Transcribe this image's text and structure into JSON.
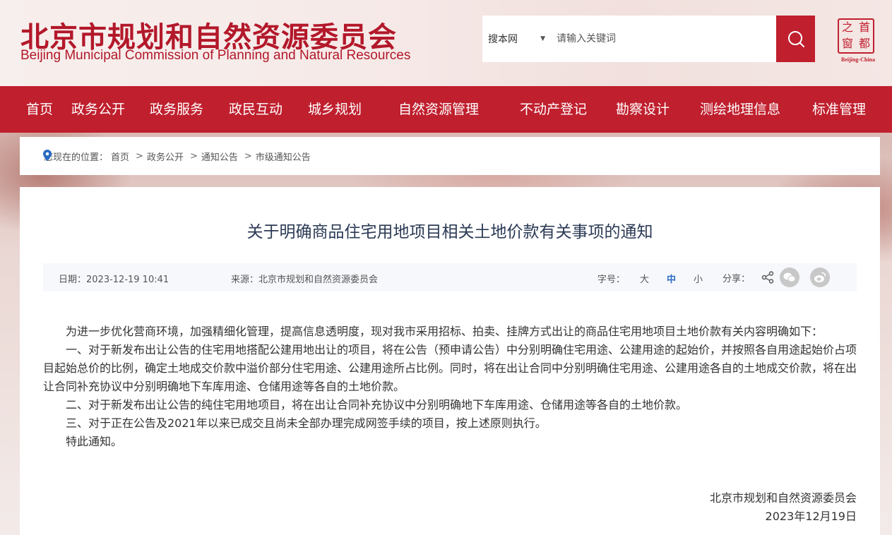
{
  "header": {
    "title_cn": "北京市规划和自然资源委员会",
    "title_en": "Beijing Municipal Commission of Planning and Natural Resources",
    "search": {
      "scope": "搜本网",
      "placeholder": "请输入关键词"
    },
    "seal": {
      "chars": [
        "之",
        "首",
        "窗",
        "都"
      ],
      "label": "Beijing-China"
    }
  },
  "nav": {
    "items": [
      "首页",
      "政务公开",
      "政务服务",
      "政民互动",
      "城乡规划",
      "自然资源管理",
      "不动产登记",
      "勘察设计",
      "测绘地理信息",
      "标准管理"
    ]
  },
  "breadcrumb": {
    "prefix": "您现在的位置：",
    "items": [
      "首页",
      "政务公开",
      "通知公告",
      "市级通知公告"
    ],
    "separator": ">"
  },
  "article": {
    "title": "关于明确商品住宅用地项目相关土地价款有关事项的通知",
    "meta": {
      "date": "日期：2023-12-19 10:41",
      "source": "来源：北京市规划和自然资源委员会",
      "font_size_label": "字号：",
      "font_sizes": [
        "大",
        "中",
        "小"
      ],
      "share_label": "分享："
    },
    "paragraphs": [
      "为进一步优化营商环境，加强精细化管理，提高信息透明度，现对我市采用招标、拍卖、挂牌方式出让的商品住宅用地项目土地价款有关内容明确如下：",
      "一、对于新发布出让公告的住宅用地搭配公建用地出让的项目，将在公告（预申请公告）中分别明确住宅用途、公建用途的起始价，并按照各自用途起始价占项目起始总价的比例，确定土地成交价款中溢价部分住宅用途、公建用途所占比例。同时，将在出让合同中分别明确住宅用途、公建用途各自的土地成交价款，将在出让合同补充协议中分别明确地下车库用途、仓储用途等各自的土地价款。",
      "二、对于新发布出让公告的纯住宅用地项目，将在出让合同补充协议中分别明确地下车库用途、仓储用途等各自的土地价款。",
      "三、对于正在公告及2021年以来已成交且尚未全部办理完成网签手续的项目，按上述原则执行。",
      "特此通知。"
    ],
    "signature": "北京市规划和自然资源委员会",
    "sign_date": "2023年12月19日"
  },
  "colors": {
    "brand_red": "#c01f2e",
    "title_navy": "#2b3a55",
    "active_blue": "#2a6bc4"
  }
}
